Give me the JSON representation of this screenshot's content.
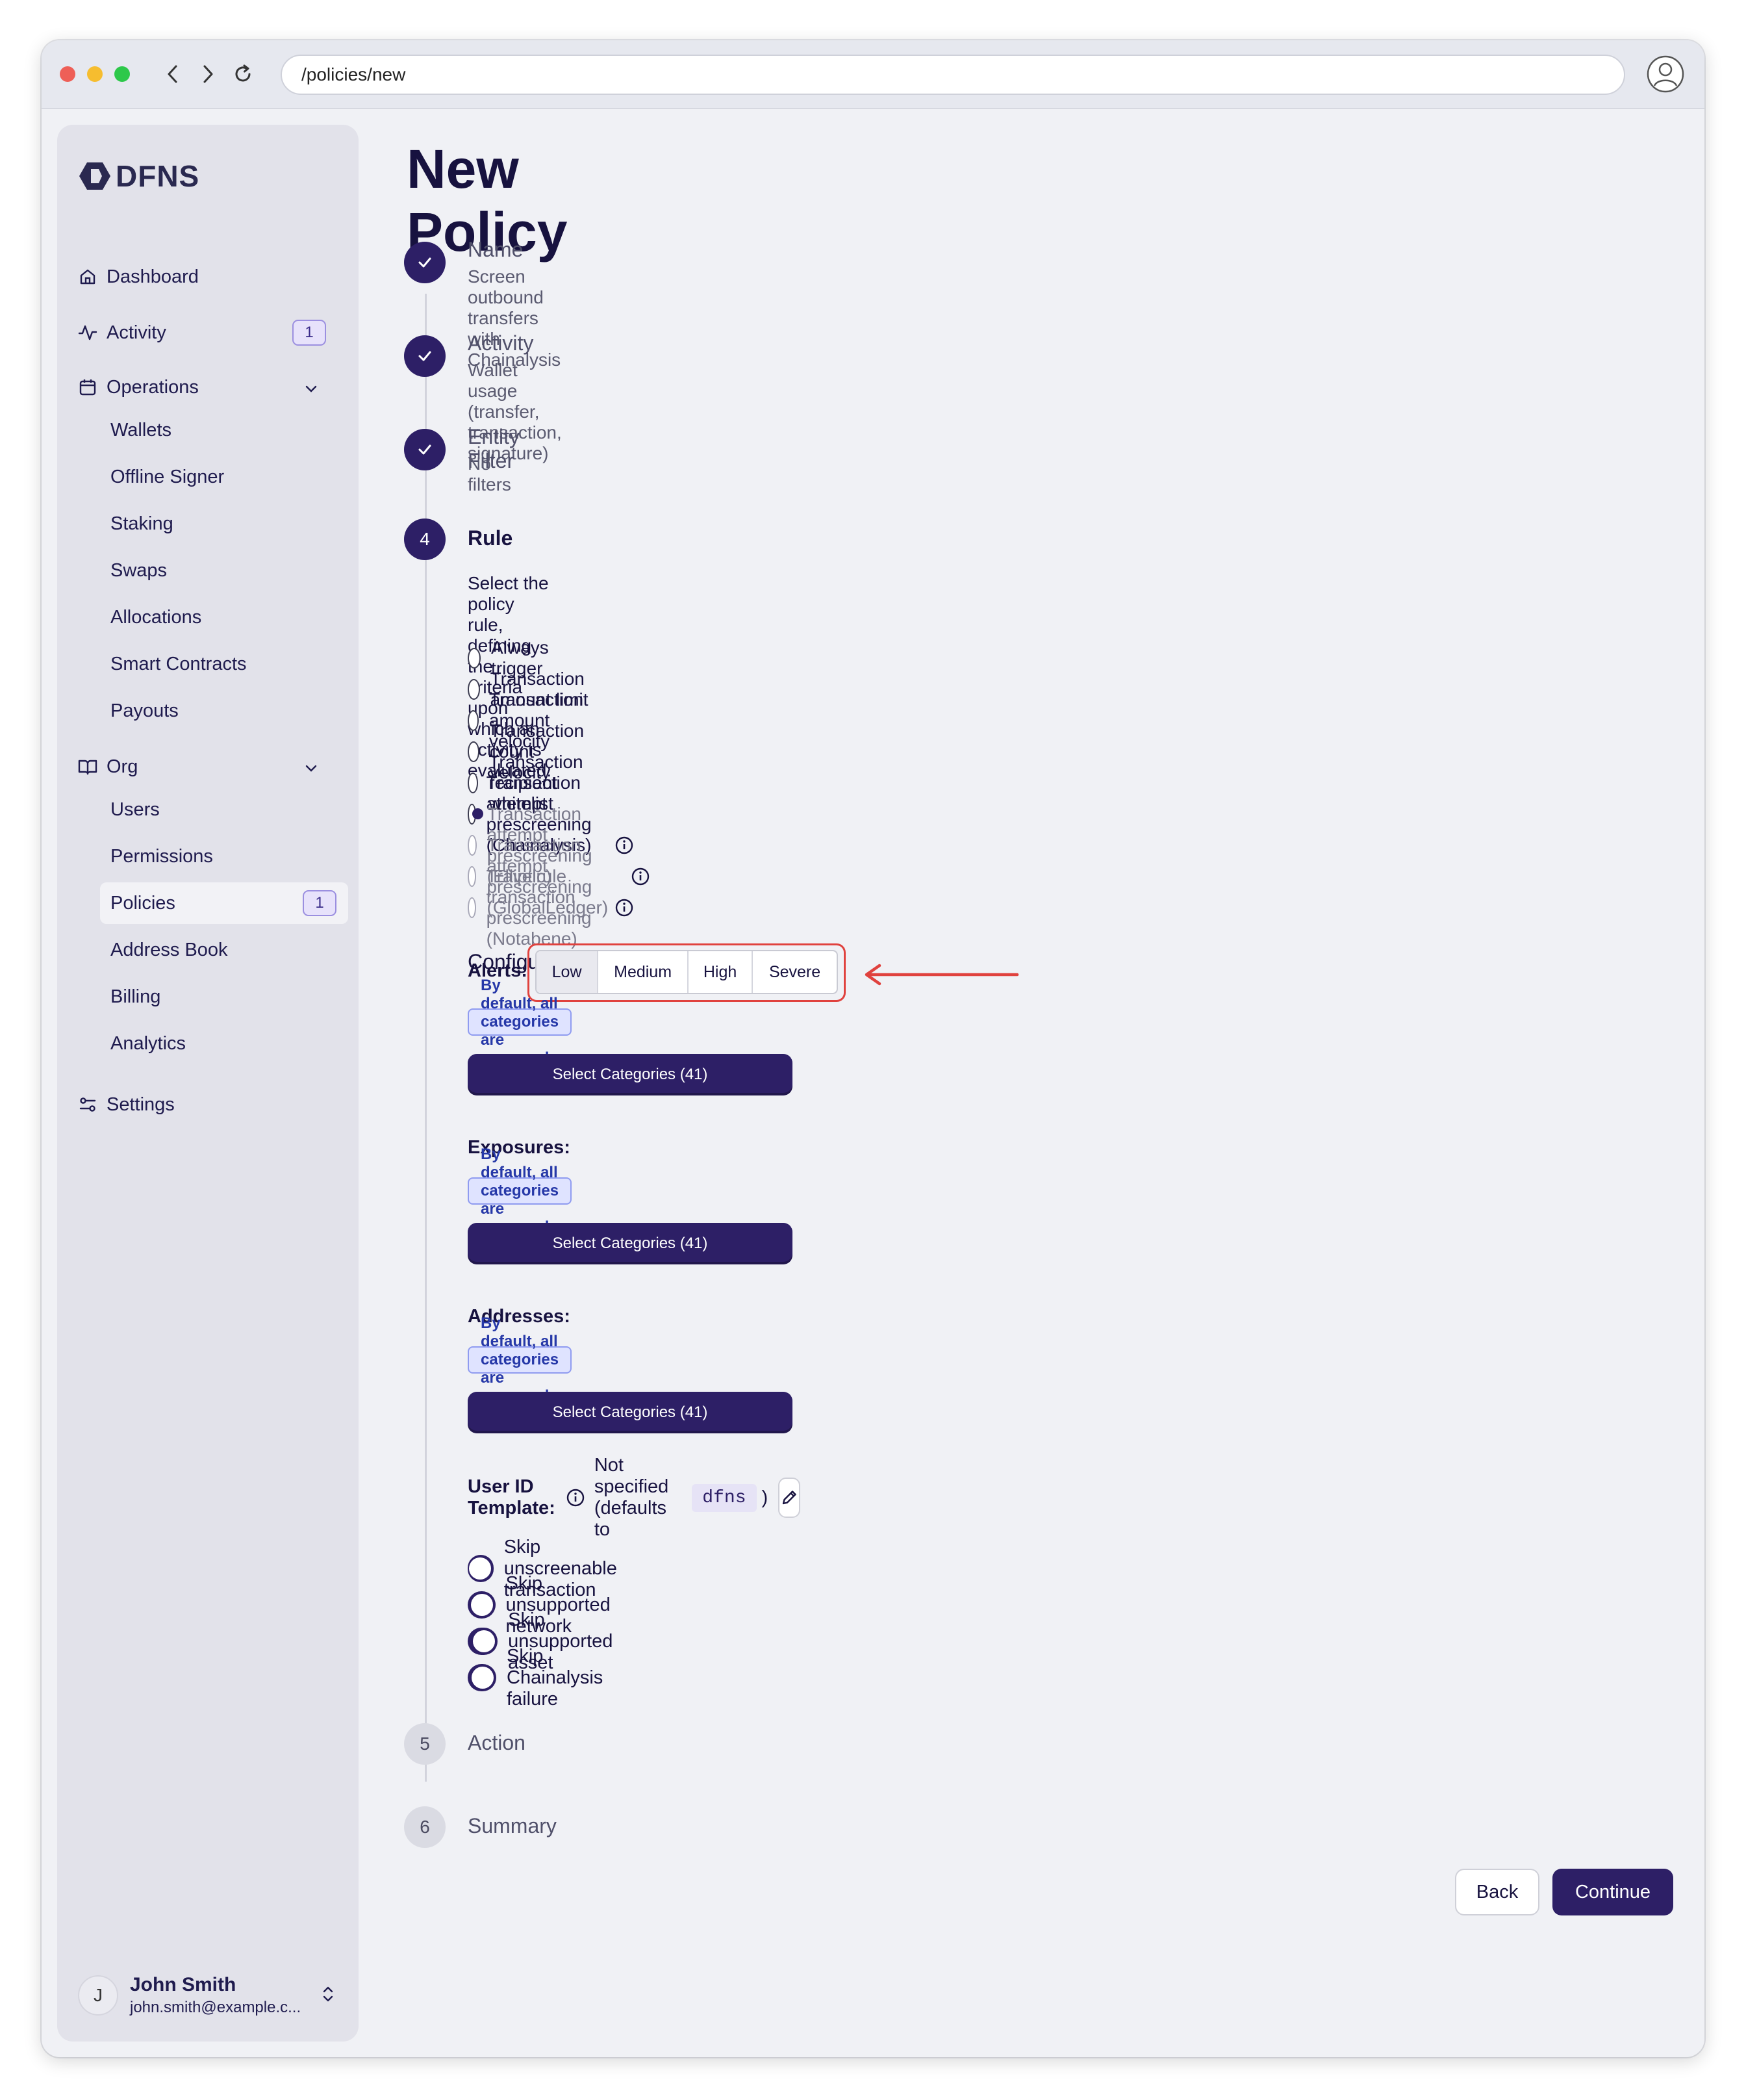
{
  "browser": {
    "url": "/policies/new"
  },
  "brand": {
    "name": "DFNS"
  },
  "sidebar": {
    "items": [
      {
        "label": "Dashboard",
        "icon": "home-icon"
      },
      {
        "label": "Activity",
        "icon": "activity-icon",
        "badge": "1"
      },
      {
        "label": "Operations",
        "icon": "calendar-icon"
      },
      {
        "label": "Org",
        "icon": "book-icon"
      },
      {
        "label": "Settings",
        "icon": "sliders-icon"
      }
    ],
    "operations": [
      "Wallets",
      "Offline Signer",
      "Staking",
      "Swaps",
      "Allocations",
      "Smart Contracts",
      "Payouts"
    ],
    "org": [
      "Users",
      "Permissions",
      "Policies",
      "Address Book",
      "Billing",
      "Analytics"
    ],
    "policies_badge": "1",
    "active": "Policies"
  },
  "user": {
    "initial": "J",
    "name": "John Smith",
    "email": "john.smith@example.c..."
  },
  "page": {
    "title": "New Policy"
  },
  "steps": [
    {
      "title": "Name",
      "subtitle": "Screen outbound transfers with Chainalysis"
    },
    {
      "title": "Activity",
      "subtitle": "Wallet usage (transfer, transaction, signature)"
    },
    {
      "title": "Entity Filter",
      "subtitle": "No filters"
    },
    {
      "number": "4",
      "title": "Rule"
    },
    {
      "number": "5",
      "title": "Action"
    },
    {
      "number": "6",
      "title": "Summary"
    }
  ],
  "rule": {
    "intro": "Select the policy rule, defining the criteria upon which an activity is evaluated:",
    "options": [
      "Always trigger",
      "Transaction amount limit",
      "Transaction amount velocity",
      "Transaction count velocity",
      "Transaction recipient whitelist",
      "Transaction attempt prescreening (Chainalysis)",
      "Transaction attempt prescreening (Elliptic)",
      "Transaction attempt prescreening (GlobalLedger)",
      "Travelrule transaction prescreening (Notabene)"
    ],
    "selected": "Transaction attempt prescreening (Chainalysis)"
  },
  "config": {
    "heading": "Configuration:",
    "alerts_label": "Alerts:",
    "levels": [
      "Low",
      "Medium",
      "High",
      "Severe"
    ],
    "selected_level": "Low",
    "default_note": "By default, all categories are screened.",
    "select_button": "Select Categories (41)",
    "exposures_label": "Exposures:",
    "addresses_label": "Addresses:"
  },
  "user_id": {
    "label": "User ID Template:",
    "text_before": "Not specified (defaults to",
    "code": "dfns",
    "text_after": ")"
  },
  "toggles": [
    "Skip unscreenable transaction",
    "Skip unsupported network",
    "Skip unsupported asset",
    "Skip Chainalysis failure"
  ],
  "actions": {
    "back": "Back",
    "continue": "Continue"
  },
  "colors": {
    "accent": "#2d1f66",
    "annotation": "#e0423e",
    "note_bg": "#dfe3ff"
  }
}
